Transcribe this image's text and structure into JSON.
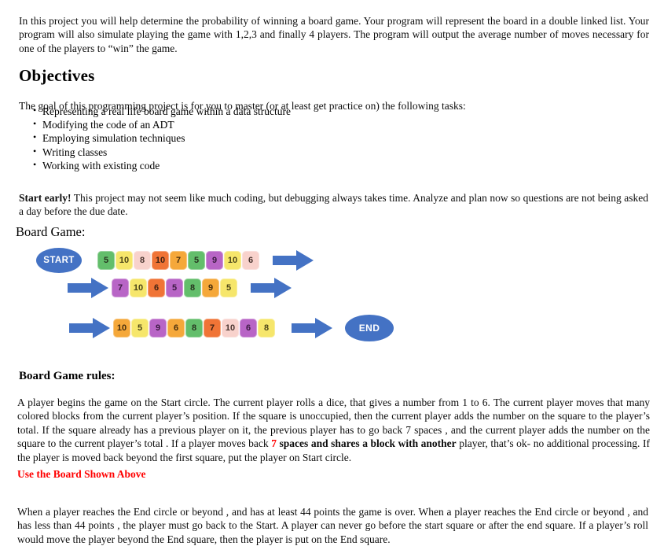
{
  "document": {
    "intro_paragraph": "In this project you will help determine the probability of winning a board game. Your program will represent the board in a double linked list. Your program will also simulate playing the game with 1,2,3 and finally 4 players.  The program will output the average number of moves necessary for one of the players to “win” the game.",
    "objectives_heading": "Objectives",
    "objectives_intro": "The goal of this programming project is for you to master (or at least get practice on) the following tasks:",
    "objectives_items": [
      "Representing a real life board game within a data structure",
      "Modifying the code of an ADT",
      "Employing simulation techniques",
      "Writing classes",
      "Working with existing code"
    ],
    "start_early_bold": "Start early!",
    "start_early_text": " This project may not seem like much coding, but debugging always takes time. Analyze and plan now so questions are not being asked a day  before the due date.",
    "board_game_label": "Board Game:",
    "rules_heading": "Board Game rules:",
    "rules_part1": "A player begins the game on the Start circle. The current player rolls a dice, that gives a number from 1 to 6. The current player moves that many colored blocks from the current player’s position. If the square is unoccupied, then the current player adds the number on the square to the player’s total. If the square already has a previous player on it, the previous player has to go back 7 spaces  , and the current player adds the number on the square to the current player’s total  . If a player moves back ",
    "rules_red_number": "7",
    "rules_bold_phrase": " spaces and shares a block with another",
    "rules_part2": " player, that’s ok- no additional processing. If the player is moved back beyond the first square, put the player on Start circle.",
    "use_board_notice": "Use the Board Shown Above",
    "final_paragraph": "When a player reaches the End circle or beyond , and has at least 44 points the game is over.  When a player reaches the End circle or beyond , and has less than 44 points , the player must go back to the Start. A player can never go before the start square or after the end square. If a player’s roll would move the player beyond the End square, then the player is put on the End square."
  },
  "board": {
    "start_label": "START",
    "end_label": "END",
    "accent_color": "#4472C4",
    "colors": {
      "green": "#63BE6B",
      "yellow": "#F6E66B",
      "pink": "#F8D2CC",
      "red": "#F07436",
      "orange": "#F5A83A",
      "purple": "#B865C6"
    },
    "rows": [
      {
        "name": "row-1",
        "blocks": [
          {
            "value": "5",
            "color": "green"
          },
          {
            "value": "10",
            "color": "yellow"
          },
          {
            "value": "8",
            "color": "pink"
          },
          {
            "value": "10",
            "color": "red"
          },
          {
            "value": "7",
            "color": "orange"
          },
          {
            "value": "5",
            "color": "green"
          },
          {
            "value": "9",
            "color": "purple"
          },
          {
            "value": "10",
            "color": "yellow"
          },
          {
            "value": "6",
            "color": "pink"
          }
        ]
      },
      {
        "name": "row-2",
        "blocks": [
          {
            "value": "7",
            "color": "purple"
          },
          {
            "value": "10",
            "color": "yellow"
          },
          {
            "value": "6",
            "color": "red"
          },
          {
            "value": "5",
            "color": "purple"
          },
          {
            "value": "8",
            "color": "green"
          },
          {
            "value": "9",
            "color": "orange"
          },
          {
            "value": "5",
            "color": "yellow"
          }
        ]
      },
      {
        "name": "row-3",
        "blocks": [
          {
            "value": "10",
            "color": "orange"
          },
          {
            "value": "5",
            "color": "yellow"
          },
          {
            "value": "9",
            "color": "purple"
          },
          {
            "value": "6",
            "color": "orange"
          },
          {
            "value": "8",
            "color": "green"
          },
          {
            "value": "7",
            "color": "red"
          },
          {
            "value": "10",
            "color": "pink"
          },
          {
            "value": "6",
            "color": "purple"
          },
          {
            "value": "8",
            "color": "yellow"
          }
        ]
      }
    ]
  }
}
